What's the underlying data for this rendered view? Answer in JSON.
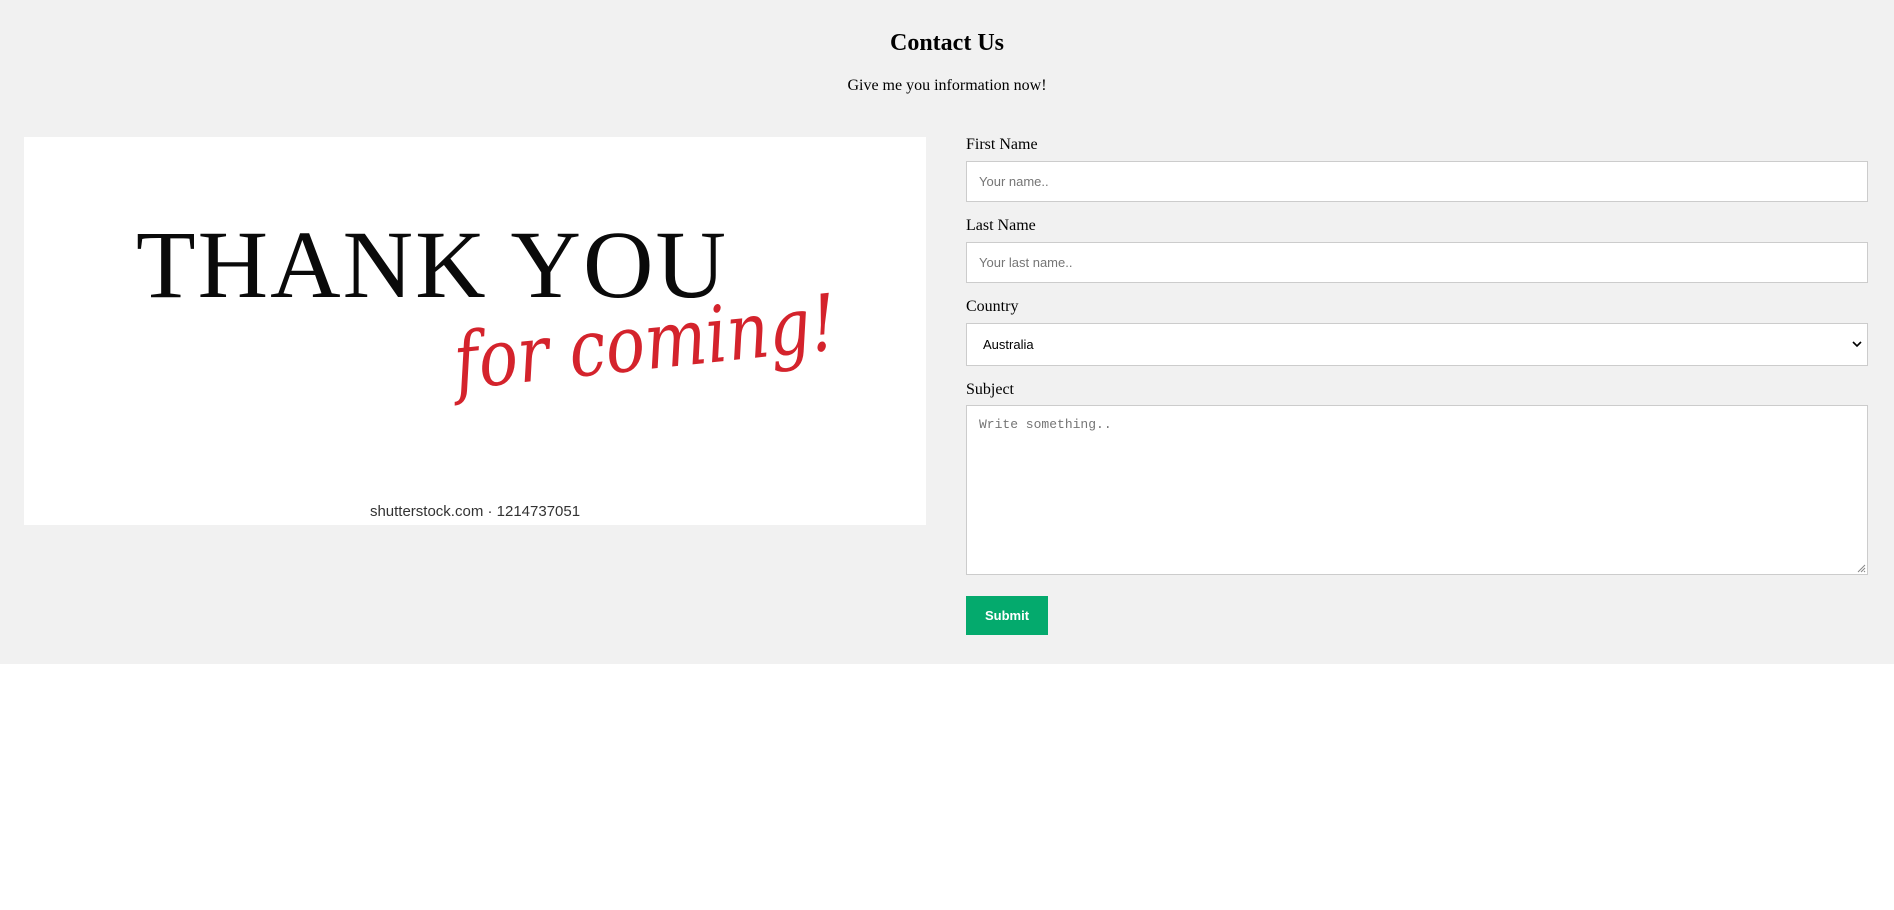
{
  "header": {
    "title": "Contact Us",
    "subtitle": "Give me you information now!"
  },
  "image": {
    "headline": "THANK YOU",
    "script_line": "for coming!",
    "watermark": "shutterstock.com · 1214737051",
    "headline_color": "#0a0a0a",
    "script_color": "#d4232c"
  },
  "form": {
    "first_name": {
      "label": "First Name",
      "placeholder": "Your name..",
      "value": ""
    },
    "last_name": {
      "label": "Last Name",
      "placeholder": "Your last name..",
      "value": ""
    },
    "country": {
      "label": "Country",
      "selected": "Australia",
      "icon": "chevron-down-icon"
    },
    "subject": {
      "label": "Subject",
      "placeholder": "Write something..",
      "value": ""
    },
    "submit_label": "Submit"
  },
  "colors": {
    "section_background": "#f1f1f1",
    "submit_button": "#04aa6d",
    "input_border": "#cccccc"
  }
}
